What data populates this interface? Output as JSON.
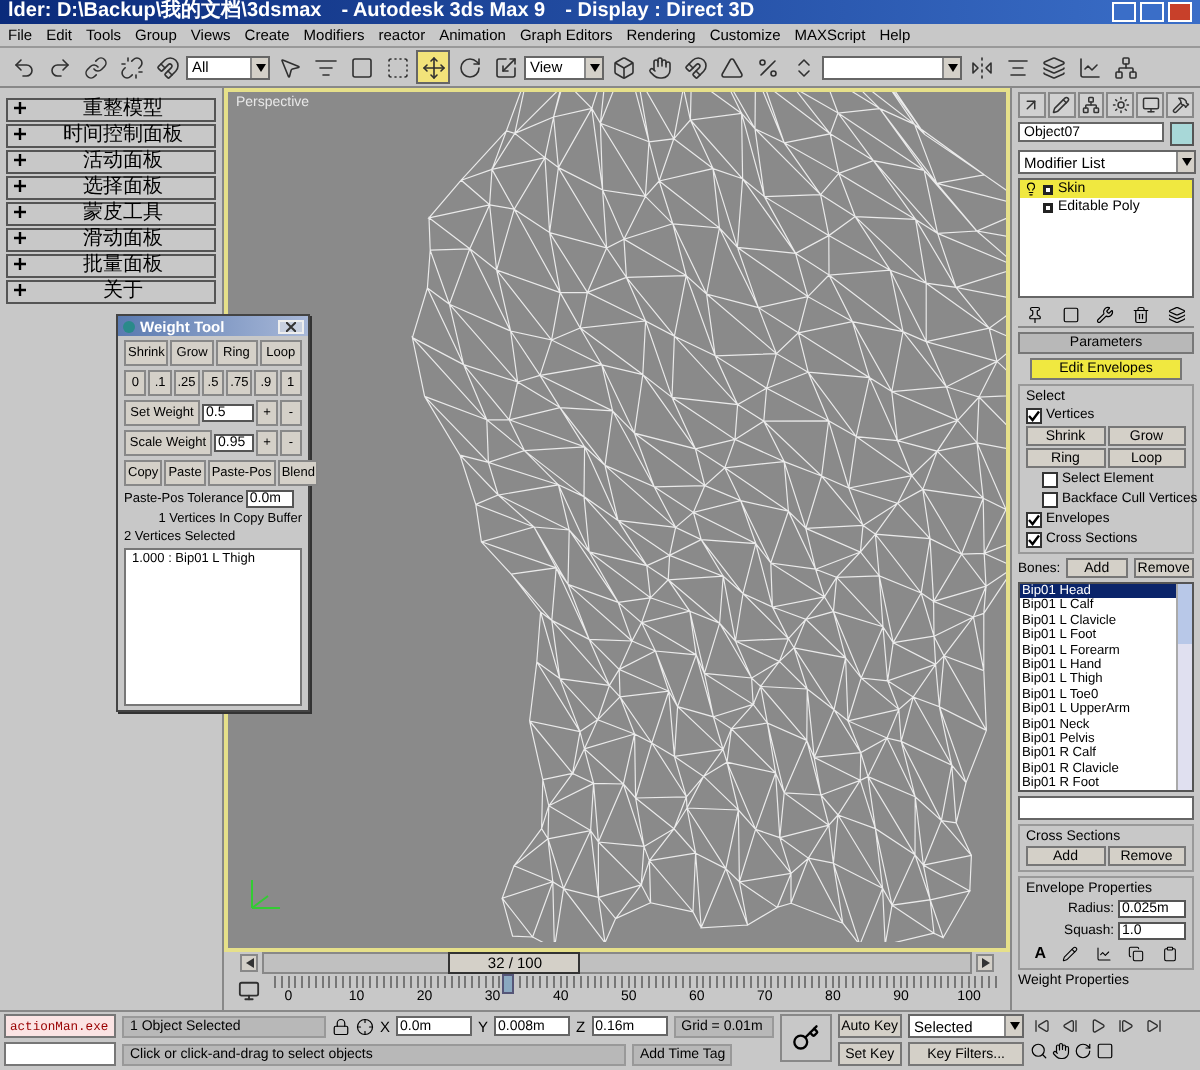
{
  "window": {
    "title": "lder: D:\\Backup\\我的文档\\3dsmax",
    "app": "- Autodesk 3ds Max 9",
    "display": "- Display : Direct 3D"
  },
  "menu": [
    "File",
    "Edit",
    "Tools",
    "Group",
    "Views",
    "Create",
    "Modifiers",
    "reactor",
    "Animation",
    "Graph Editors",
    "Rendering",
    "Customize",
    "MAXScript",
    "Help"
  ],
  "toolbar": {
    "selection_filter": "All",
    "reference_coord": "View",
    "tools": [
      {
        "selected": false
      },
      {
        "selected": false
      },
      {
        "selected": false
      },
      {
        "selected": false
      },
      {
        "selected": false
      },
      {
        "selected": false
      },
      {
        "selected": false
      },
      {
        "selected": false
      },
      {
        "selected": false
      },
      {
        "selected": true
      },
      {
        "selected": false
      },
      {
        "selected": false
      },
      {
        "selected": false
      },
      {
        "selected": false
      },
      {
        "selected": false
      },
      {
        "selected": false
      },
      {
        "selected": false
      },
      {
        "selected": false
      },
      {
        "selected": false
      },
      {
        "selected": false
      },
      {
        "selected": false
      },
      {
        "selected": false
      },
      {
        "selected": false
      }
    ]
  },
  "rollouts": [
    "重整模型",
    "时间控制面板",
    "活动面板",
    "选择面板",
    "蒙皮工具",
    "滑动面板",
    "批量面板",
    "关于"
  ],
  "viewport": {
    "label": "Perspective",
    "active": true
  },
  "weight_tool": {
    "title": "Weight Tool",
    "select_buttons": [
      "Shrink",
      "Grow",
      "Ring",
      "Loop"
    ],
    "presets": [
      "0",
      ".1",
      ".25",
      ".5",
      ".75",
      ".9",
      "1"
    ],
    "set_weight": {
      "label": "Set Weight",
      "value": "0.5"
    },
    "scale_weight": {
      "label": "Scale Weight",
      "value": "0.95"
    },
    "plus": "+",
    "minus": "-",
    "copy_buttons": [
      "Copy",
      "Paste",
      "Paste-Pos",
      "Blend"
    ],
    "tolerance": {
      "label": "Paste-Pos Tolerance",
      "value": "0.0m"
    },
    "buffer_note": "1 Vertices In Copy Buffer",
    "selected_note": "2 Vertices Selected",
    "weights": [
      "1.000 : Bip01 L Thigh"
    ]
  },
  "command_panel": {
    "object_name": "Object07",
    "modifier_list": "Modifier List",
    "stack": [
      {
        "label": "Skin",
        "selected": true
      },
      {
        "label": "Editable Poly",
        "selected": false
      }
    ],
    "parameters": {
      "title": "Parameters",
      "edit_envelopes": "Edit Envelopes",
      "select_group": "Select",
      "vertices": {
        "label": "Vertices",
        "checked": true
      },
      "select_buttons": [
        "Shrink",
        "Grow",
        "Ring",
        "Loop"
      ],
      "options": [
        {
          "label": "Select Element",
          "checked": false
        },
        {
          "label": "Backface Cull Vertices",
          "checked": false
        },
        {
          "label": "Envelopes",
          "checked": true
        },
        {
          "label": "Cross Sections",
          "checked": true
        }
      ],
      "bones_label": "Bones:",
      "add": "Add",
      "remove": "Remove",
      "bones": [
        {
          "label": "Bip01 Head",
          "selected": true
        },
        {
          "label": "Bip01 L Calf",
          "selected": false
        },
        {
          "label": "Bip01 L Clavicle",
          "selected": false
        },
        {
          "label": "Bip01 L Foot",
          "selected": false
        },
        {
          "label": "Bip01 L Forearm",
          "selected": false
        },
        {
          "label": "Bip01 L Hand",
          "selected": false
        },
        {
          "label": "Bip01 L Thigh",
          "selected": false
        },
        {
          "label": "Bip01 L Toe0",
          "selected": false
        },
        {
          "label": "Bip01 L UpperArm",
          "selected": false
        },
        {
          "label": "Bip01 Neck",
          "selected": false
        },
        {
          "label": "Bip01 Pelvis",
          "selected": false
        },
        {
          "label": "Bip01 R Calf",
          "selected": false
        },
        {
          "label": "Bip01 R Clavicle",
          "selected": false
        },
        {
          "label": "Bip01 R Foot",
          "selected": false
        }
      ],
      "cross_sections": {
        "title": "Cross Sections",
        "add": "Add",
        "remove": "Remove"
      },
      "envelope": {
        "title": "Envelope Properties",
        "radius_label": "Radius:",
        "radius": "0.025m",
        "squash_label": "Squash:",
        "squash": "1.0",
        "absolute": "A"
      },
      "weight_properties": "Weight Properties"
    }
  },
  "timeline": {
    "frame": "32 / 100",
    "level": 0.32,
    "ticks": [
      "0",
      "10",
      "20",
      "30",
      "40",
      "50",
      "60",
      "70",
      "80",
      "90",
      "100"
    ]
  },
  "status": {
    "script_field": "actionMan.exe",
    "selection": "1 Object Selected",
    "prompt": "Click or click-and-drag to select objects",
    "x_label": "X",
    "x": "0.0m",
    "y_label": "Y",
    "y": "0.008m",
    "z_label": "Z",
    "z": "0.16m",
    "grid": "Grid = 0.01m",
    "time_tag": "Add Time Tag",
    "auto_key": "Auto Key",
    "set_key": "Set Key",
    "key_mode": "Selected",
    "key_filters": "Key Filters..."
  }
}
